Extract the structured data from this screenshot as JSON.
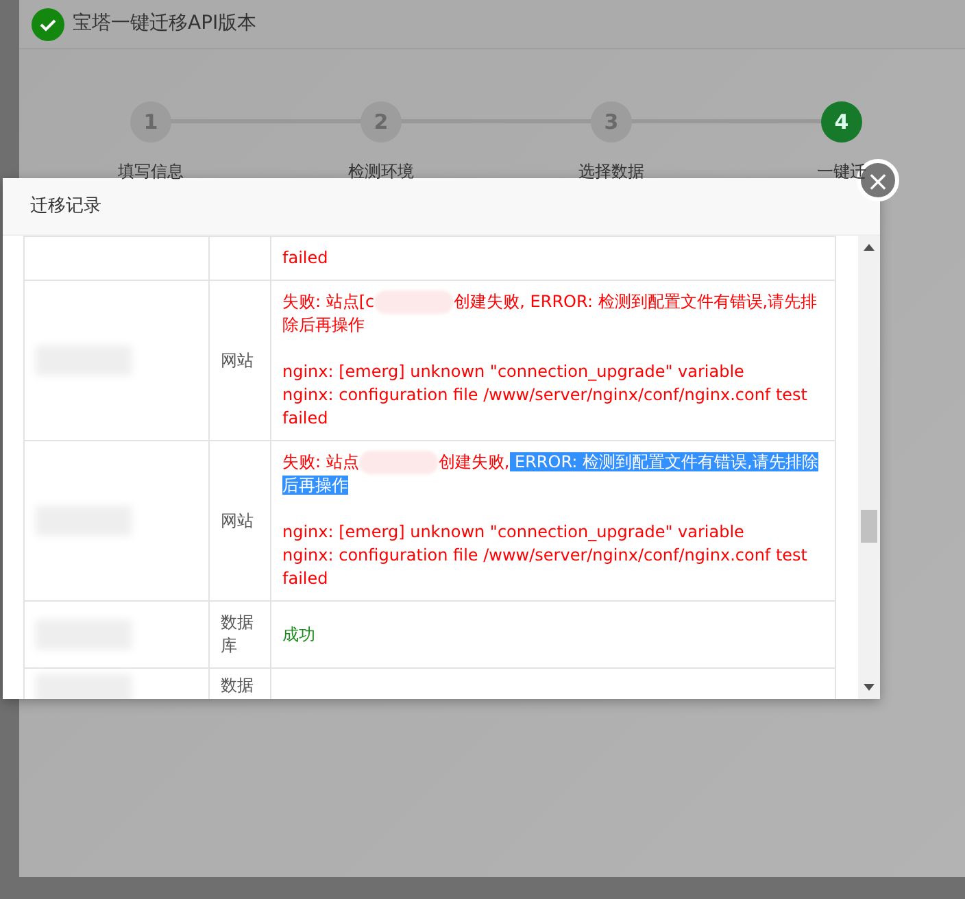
{
  "window": {
    "title": "宝塔一键迁移API版本"
  },
  "steps": [
    {
      "number": "1",
      "label": "填写信息",
      "selected": false
    },
    {
      "number": "2",
      "label": "检测环境",
      "selected": false
    },
    {
      "number": "3",
      "label": "选择数据",
      "selected": false
    },
    {
      "number": "4",
      "label": "一键迁",
      "selected": true
    }
  ],
  "modal": {
    "title": "迁移记录",
    "close": "×",
    "rows": [
      {
        "kind": "error",
        "segments": [],
        "details": [
          "failed"
        ]
      },
      {
        "type": "网站",
        "kind": "error",
        "segments": [
          {
            "text": "失败: 站点[c",
            "highlighted": false
          },
          {
            "kind": "redacted"
          },
          {
            "text": "创建失败, ERROR: 检测到配置文件有错误,请先排除后再操作",
            "highlighted": false
          }
        ],
        "details": [
          "nginx: [emerg] unknown \"connection_upgrade\" variable",
          "nginx: configuration file /www/server/nginx/conf/nginx.conf test failed"
        ]
      },
      {
        "type": "网站",
        "kind": "error",
        "segments": [
          {
            "text": "失败: 站点",
            "highlighted": false
          },
          {
            "kind": "redacted"
          },
          {
            "text": "创建失败,",
            "highlighted": false
          },
          {
            "text": " ERROR: 检测到配置文件有错误,请先排除后再操作",
            "highlighted": true
          }
        ],
        "details": [
          "nginx: [emerg] unknown \"connection_upgrade\" variable",
          "nginx: configuration file /www/server/nginx/conf/nginx.conf test failed"
        ]
      },
      {
        "type": "数据库",
        "kind": "success",
        "segments": [
          {
            "text": "成功",
            "highlighted": false
          }
        ],
        "details": []
      },
      {
        "type": "数据",
        "kind": "empty",
        "segments": [],
        "details": []
      }
    ]
  }
}
